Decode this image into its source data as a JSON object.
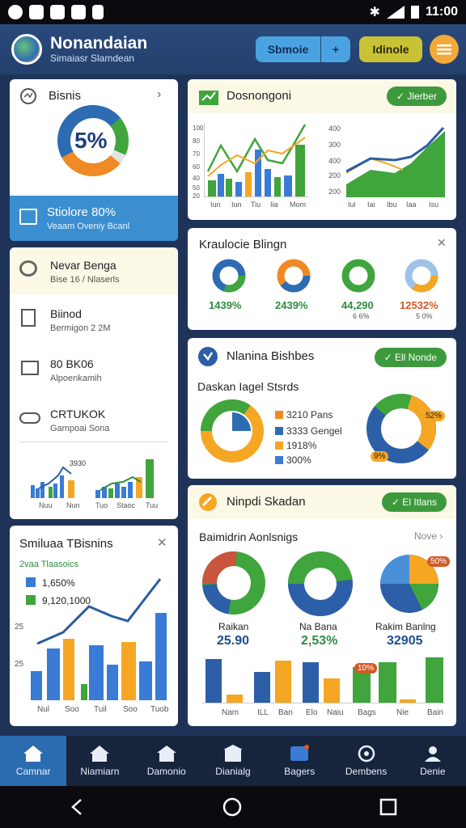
{
  "status": {
    "time": "11:00"
  },
  "header": {
    "title": "Nonandaian",
    "subtitle": "Simaiasr Slamdean",
    "btn1": "Sbmoie",
    "btn1_plus": "+",
    "btn2": "Idinole"
  },
  "card1": {
    "title": "Bisnis",
    "donut_value": "5%",
    "highlight_title": "Stiolore 80%",
    "highlight_sub": "Veaam Oveniy Bcanl"
  },
  "list": [
    {
      "title": "Nevar Benga",
      "sub": "Bise 16 / Nlaserls"
    },
    {
      "title": "Biinod",
      "sub": "Bermigon 2 2M"
    },
    {
      "title": "80 BK06",
      "sub": "Alpoenkamih"
    },
    {
      "title": "CRTUKOK",
      "sub": "Gampoai Sona"
    }
  ],
  "minichart": {
    "tick": "3930",
    "x": [
      "Nuu",
      "Nun",
      "Tuo",
      "Staoc",
      "Tuu"
    ]
  },
  "card_dosn": {
    "title": "Dosnongoni",
    "pill": "✓ Jlerber",
    "left_y": [
      "100",
      "80",
      "70",
      "60",
      "40",
      "50",
      "20"
    ],
    "left_x": [
      "Iun",
      "Iun",
      "Tiu",
      "Iia",
      "Mom"
    ],
    "right_y": [
      "400",
      "300",
      "400",
      "200",
      "200"
    ],
    "right_x": [
      "Iul",
      "Iai",
      "Ibu",
      "Iaa",
      "Isu"
    ]
  },
  "card_kraul": {
    "title": "Kraulocie Blingn",
    "values": [
      "1439%",
      "2439%",
      "44,290",
      "12532%"
    ],
    "subs": [
      "",
      "",
      "6 6%",
      "5 0%"
    ]
  },
  "card_nanina": {
    "title": "Nlanina Bishbes",
    "pill": "✓ Ell Nonde",
    "subtitle": "Daskan Iagel Stsrds",
    "legend": [
      "3210 Pans",
      "3333 Gengel",
      "1918%",
      "300%"
    ],
    "ring_labels": [
      "52%",
      "9%"
    ]
  },
  "card_nipp": {
    "title": "Ninpdi Skadan",
    "pill": "✓ El Itlans",
    "subtitle": "Baimidrin Aonlsnigs",
    "more": "Nove ›",
    "pies": [
      {
        "label": "Raikan",
        "value": "25.90"
      },
      {
        "label": "Na Bana",
        "value": "2,53%"
      },
      {
        "label": "Rakim Banlng",
        "value": "32905"
      }
    ],
    "badges": [
      "50%",
      "10%"
    ],
    "x": [
      "Nam",
      "ILL",
      "Ban",
      "Elo",
      "Naiu",
      "Bags",
      "Nie",
      "Bain"
    ]
  },
  "card_smiluaa": {
    "title": "Smiluaa TBisnins",
    "label": "2vaa Tlaasoics",
    "legend": [
      "1,650%",
      "9,120,1000"
    ],
    "y": [
      "25",
      "25"
    ],
    "x": [
      "Nul",
      "Soo",
      "Tuil",
      "Soo",
      "Tuob"
    ]
  },
  "nav": [
    "Camnar",
    "Niamiarn",
    "Damonio",
    "Dianialg",
    "Bagers",
    "Dembens",
    "Denie"
  ]
}
